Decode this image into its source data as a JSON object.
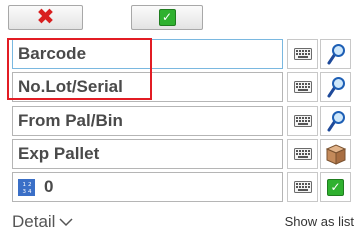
{
  "toolbar": {
    "cancel_icon": "x-icon",
    "ok_icon": "check-icon",
    "cancel_glyph": "✖",
    "ok_glyph": "✓"
  },
  "fields": [
    {
      "label": "Barcode",
      "action_icon": "search-icon"
    },
    {
      "label": "No.Lot/Serial",
      "action_icon": "search-icon"
    },
    {
      "label": "From Pal/Bin",
      "action_icon": "search-icon"
    },
    {
      "label": "Exp Pallet",
      "action_icon": "box-icon"
    },
    {
      "label": "0",
      "action_icon": "check-icon"
    }
  ],
  "footer": {
    "detail_label": "Detail",
    "show_list_label": "Show as list"
  },
  "colors": {
    "highlight": "#e21c24",
    "focused_border": "#7ab8e0",
    "check": "#2fb12f",
    "cancel": "#d91f1f"
  }
}
